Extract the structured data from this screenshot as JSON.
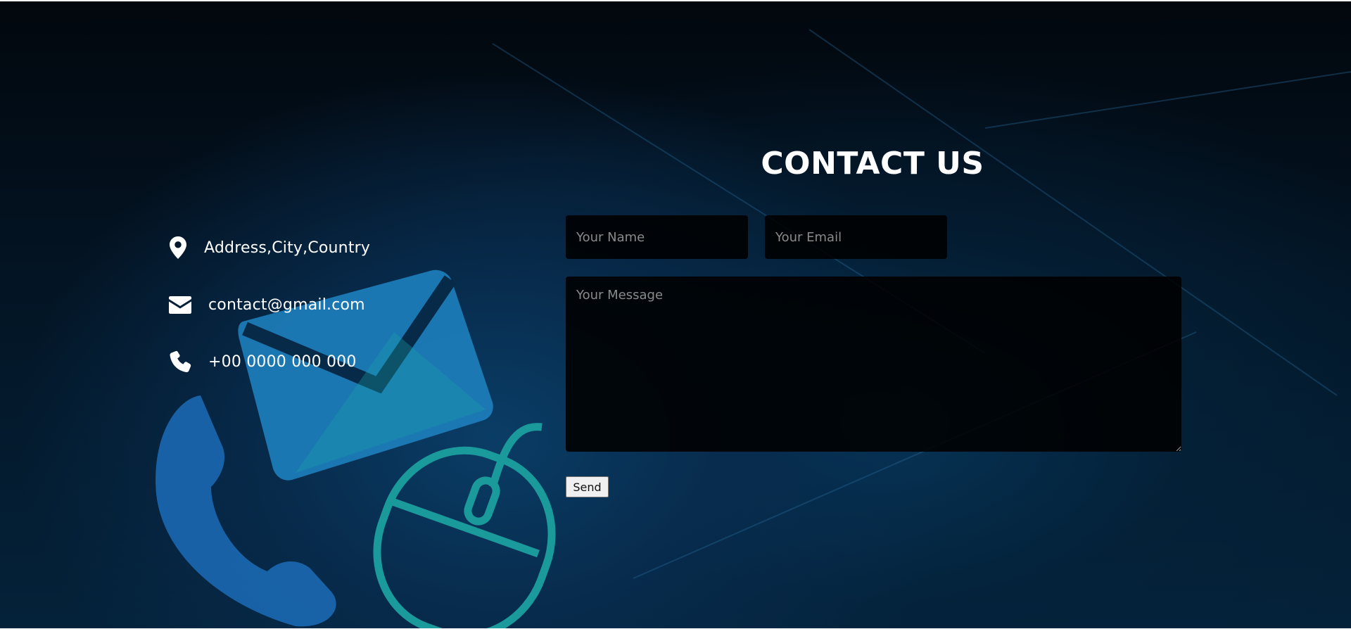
{
  "contact": {
    "title": "CONTACT US",
    "info": [
      {
        "icon": "map-marker-icon",
        "text": "Address,City,Country"
      },
      {
        "icon": "envelope-icon",
        "text": "contact@gmail.com"
      },
      {
        "icon": "phone-icon",
        "text": "+00 0000 000 000"
      }
    ],
    "form": {
      "name_placeholder": "Your Name",
      "email_placeholder": "Your Email",
      "message_placeholder": "Your Message",
      "send_label": "Send"
    }
  },
  "colors": {
    "background_dark": "#02070d",
    "background_blue": "#0a3d66",
    "text": "#ffffff",
    "field_background": "#000000",
    "art_blue": "#1a6fb5",
    "art_teal": "#1a9a9a"
  }
}
